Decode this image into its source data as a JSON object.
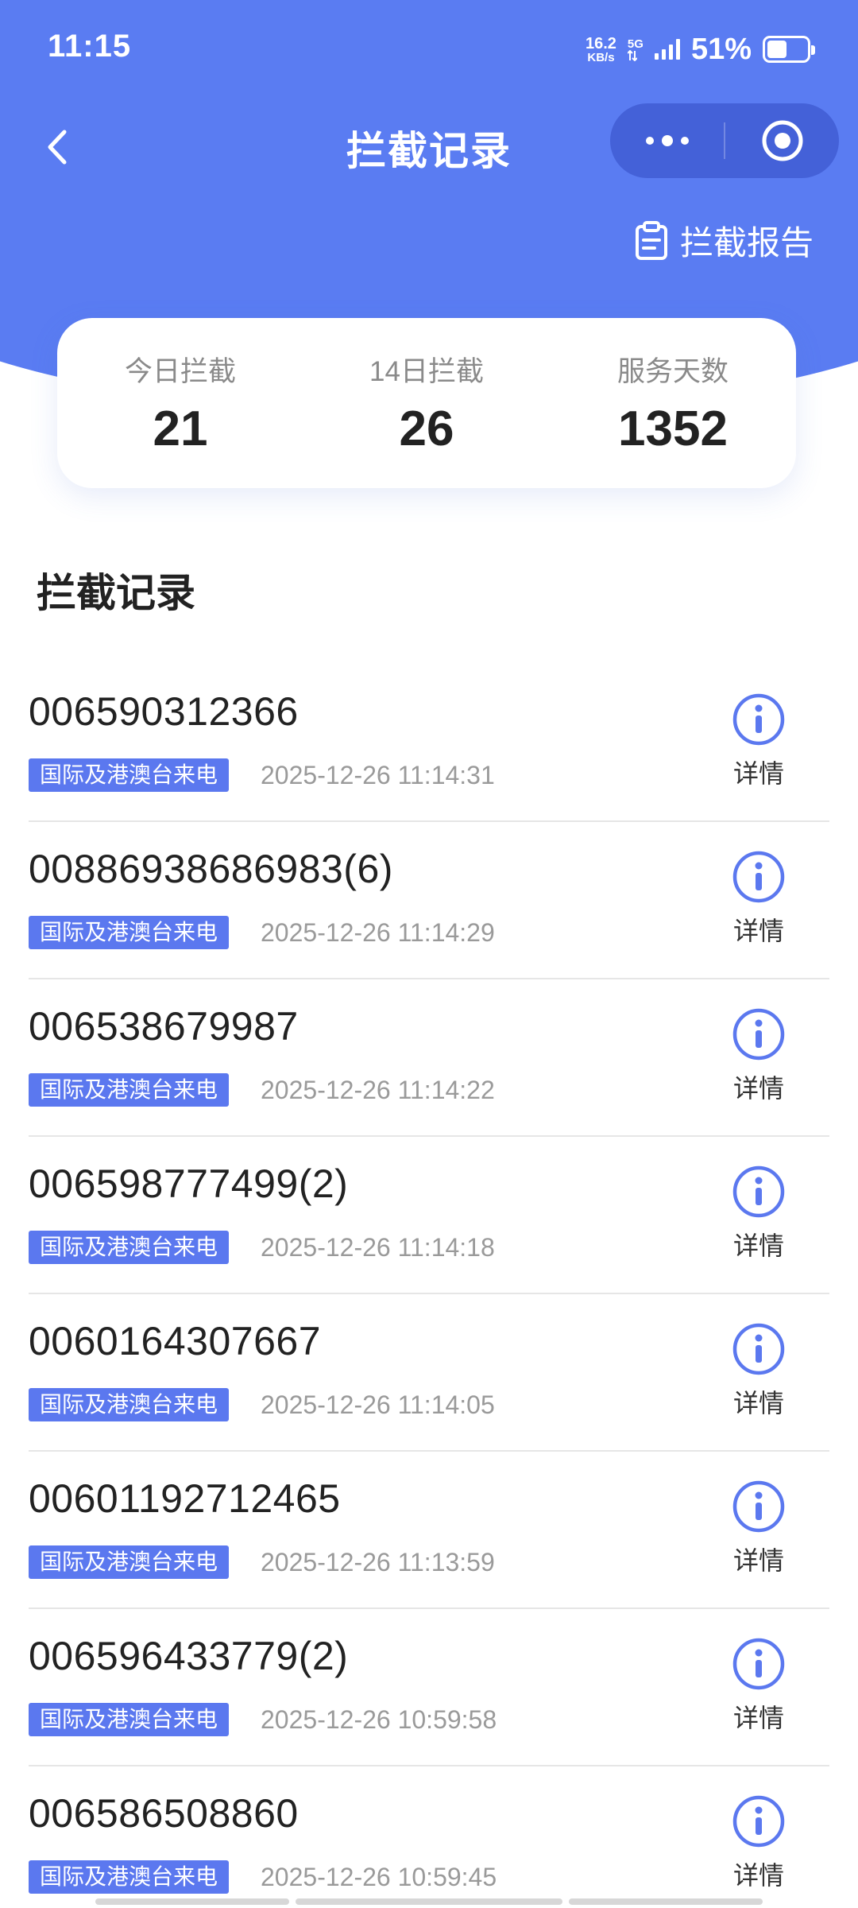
{
  "status_bar": {
    "time": "11:15",
    "net_speed_value": "16.2",
    "net_speed_unit": "KB/s",
    "network": "5G",
    "battery": "51%",
    "battery_level": 0.51
  },
  "nav": {
    "title": "拦截记录"
  },
  "report_link": "拦截报告",
  "stats": [
    {
      "label": "今日拦截",
      "value": "21"
    },
    {
      "label": "14日拦截",
      "value": "26"
    },
    {
      "label": "服务天数",
      "value": "1352"
    }
  ],
  "section_title": "拦截记录",
  "records": [
    {
      "number": "006590312366",
      "tag": "国际及港澳台来电",
      "time": "2025-12-26 11:14:31",
      "detail": "详情"
    },
    {
      "number": "00886938686983(6)",
      "tag": "国际及港澳台来电",
      "time": "2025-12-26 11:14:29",
      "detail": "详情"
    },
    {
      "number": "006538679987",
      "tag": "国际及港澳台来电",
      "time": "2025-12-26 11:14:22",
      "detail": "详情"
    },
    {
      "number": "006598777499(2)",
      "tag": "国际及港澳台来电",
      "time": "2025-12-26 11:14:18",
      "detail": "详情"
    },
    {
      "number": "0060164307667",
      "tag": "国际及港澳台来电",
      "time": "2025-12-26 11:14:05",
      "detail": "详情"
    },
    {
      "number": "00601192712465",
      "tag": "国际及港澳台来电",
      "time": "2025-12-26 11:13:59",
      "detail": "详情"
    },
    {
      "number": "006596433779(2)",
      "tag": "国际及港澳台来电",
      "time": "2025-12-26 10:59:58",
      "detail": "详情"
    },
    {
      "number": "006586508860",
      "tag": "国际及港澳台来电",
      "time": "2025-12-26 10:59:45",
      "detail": "详情"
    }
  ],
  "icons": {
    "back": "chevron-left-icon",
    "more": "more-dots-icon",
    "close": "target-circle-icon",
    "report": "clipboard-icon",
    "detail": "info-circle-icon"
  },
  "colors": {
    "primary": "#5a7cf2",
    "capsule": "#4461d8",
    "tag": "#5b78ef"
  }
}
